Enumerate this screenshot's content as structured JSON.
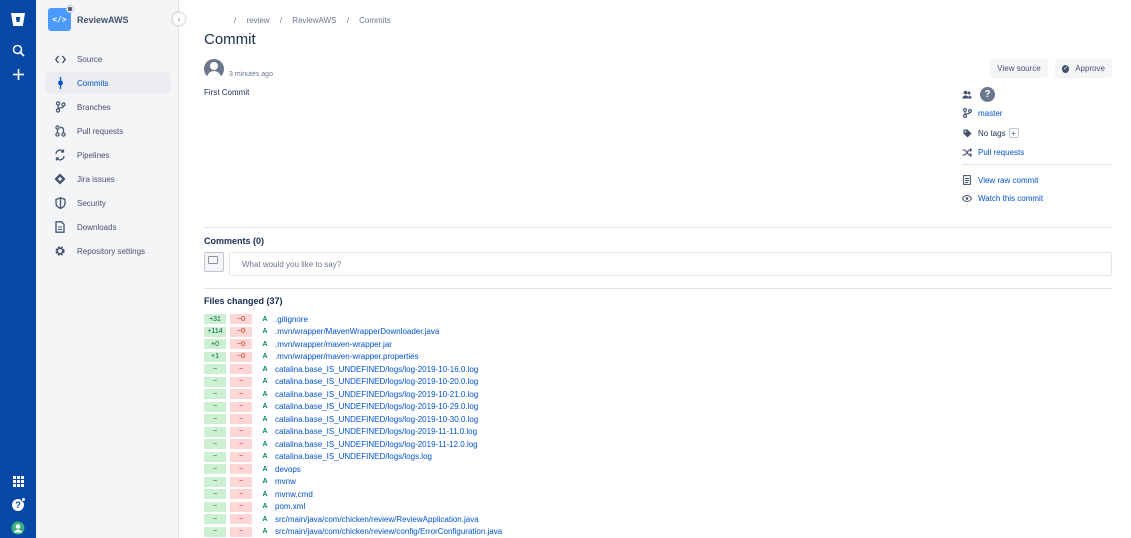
{
  "repo": {
    "name": "ReviewAWS",
    "avatar_glyph": "</>"
  },
  "sidebar": {
    "items": [
      {
        "label": "Source",
        "icon": "code-icon",
        "active": false
      },
      {
        "label": "Commits",
        "icon": "commit-icon",
        "active": true
      },
      {
        "label": "Branches",
        "icon": "branch-icon",
        "active": false
      },
      {
        "label": "Pull requests",
        "icon": "pull-request-icon",
        "active": false
      },
      {
        "label": "Pipelines",
        "icon": "pipelines-icon",
        "active": false
      },
      {
        "label": "Jira issues",
        "icon": "jira-icon",
        "active": false
      },
      {
        "label": "Security",
        "icon": "shield-icon",
        "active": false
      },
      {
        "label": "Downloads",
        "icon": "document-icon",
        "active": false
      },
      {
        "label": "Repository settings",
        "icon": "gear-icon",
        "active": false
      }
    ]
  },
  "breadcrumbs": {
    "sep": "/",
    "items": [
      "review",
      "ReviewAWS",
      "Commits"
    ]
  },
  "page": {
    "title": "Commit"
  },
  "commit": {
    "time": "3 minutes ago",
    "message": "First Commit"
  },
  "actions": {
    "view_source": "View source",
    "approve": "Approve"
  },
  "meta": {
    "branch": "master",
    "tags": "No tags",
    "tags_add": "+",
    "pull_requests": "Pull requests",
    "view_raw": "View raw commit",
    "watch": "Watch this commit",
    "unknown_glyph": "?"
  },
  "comments": {
    "title": "Comments (0)",
    "placeholder": "What would you like to say?"
  },
  "files": {
    "title": "Files changed (37)",
    "rows": [
      {
        "add": "+31",
        "del": "−0",
        "status": "A",
        "path": ".gitignore"
      },
      {
        "add": "+114",
        "del": "−0",
        "status": "A",
        "path": ".mvn/wrapper/MavenWrapperDownloader.java"
      },
      {
        "add": "+0",
        "del": "−0",
        "status": "A",
        "path": ".mvn/wrapper/maven-wrapper.jar"
      },
      {
        "add": "+1",
        "del": "−0",
        "status": "A",
        "path": ".mvn/wrapper/maven-wrapper.properties"
      },
      {
        "add": "−",
        "del": "−",
        "status": "A",
        "path": "catalina.base_IS_UNDEFINED/logs/log-2019-10-16.0.log"
      },
      {
        "add": "−",
        "del": "−",
        "status": "A",
        "path": "catalina.base_IS_UNDEFINED/logs/log-2019-10-20.0.log"
      },
      {
        "add": "−",
        "del": "−",
        "status": "A",
        "path": "catalina.base_IS_UNDEFINED/logs/log-2019-10-21.0.log"
      },
      {
        "add": "−",
        "del": "−",
        "status": "A",
        "path": "catalina.base_IS_UNDEFINED/logs/log-2019-10-29.0.log"
      },
      {
        "add": "−",
        "del": "−",
        "status": "A",
        "path": "catalina.base_IS_UNDEFINED/logs/log-2019-10-30.0.log"
      },
      {
        "add": "−",
        "del": "−",
        "status": "A",
        "path": "catalina.base_IS_UNDEFINED/logs/log-2019-11-11.0.log"
      },
      {
        "add": "−",
        "del": "−",
        "status": "A",
        "path": "catalina.base_IS_UNDEFINED/logs/log-2019-11-12.0.log"
      },
      {
        "add": "−",
        "del": "−",
        "status": "A",
        "path": "catalina.base_IS_UNDEFINED/logs/logs.log"
      },
      {
        "add": "−",
        "del": "−",
        "status": "A",
        "path": "devops"
      },
      {
        "add": "−",
        "del": "−",
        "status": "A",
        "path": "mvnw"
      },
      {
        "add": "−",
        "del": "−",
        "status": "A",
        "path": "mvnw.cmd"
      },
      {
        "add": "−",
        "del": "−",
        "status": "A",
        "path": "pom.xml"
      },
      {
        "add": "−",
        "del": "−",
        "status": "A",
        "path": "src/main/java/com/chicken/review/ReviewApplication.java"
      },
      {
        "add": "−",
        "del": "−",
        "status": "A",
        "path": "src/main/java/com/chicken/review/config/ErrorConfiguration.java"
      }
    ]
  },
  "colors": {
    "global_nav": "#0747a6",
    "link": "#0052cc",
    "added_bg": "#cdf0d2",
    "removed_bg": "#ffd6d6"
  }
}
